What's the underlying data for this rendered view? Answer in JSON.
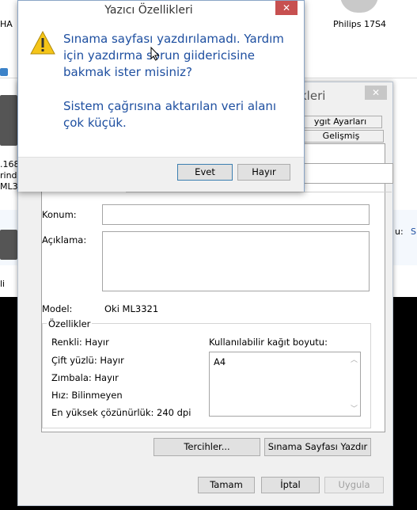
{
  "background": {
    "top_left_label": "HA",
    "monitor_label": "Philips 17S4",
    "left_printer_label_1": ".168",
    "left_printer_label_2": "rind",
    "left_printer_label_3": "ML33",
    "left_item_label": "li",
    "right_label_1": "u:",
    "right_label_2": "S"
  },
  "props_dialog": {
    "title_fragment": "kleri",
    "close_glyph": "✕",
    "tabs": [
      "ygıt Ayarları",
      "Gelişmiş"
    ],
    "location_label": "Konum:",
    "location_value": "",
    "comment_label": "Açıklama:",
    "comment_value": "",
    "model_label": "Model:",
    "model_value": "Oki ML3321",
    "features_label": "Özellikler",
    "features": {
      "color": "Renkli: Hayır",
      "duplex": "Çift yüzlü: Hayır",
      "staple": "Zımbala: Hayır",
      "speed": "Hız: Bilinmeyen",
      "resolution": "En yüksek çözünürlük: 240 dpi"
    },
    "paper_label": "Kullanılabilir kağıt boyutu:",
    "paper_sizes": [
      "A4"
    ],
    "preferences_button": "Tercihler...",
    "test_page_button": "Sınama Sayfası Yazdır",
    "ok_button": "Tamam",
    "cancel_button": "İptal",
    "apply_button": "Uygula"
  },
  "alert_dialog": {
    "title": "Yazıcı Özellikleri",
    "close_glyph": "✕",
    "message_1": "Sınama sayfası yazdırılamadı. Yardım için yazdırma sorun giidericisine bakmak ister misiniz?",
    "message_2": "Sistem çağrısına aktarılan veri alanı çok küçük.",
    "yes_button": "Evet",
    "no_button": "Hayır"
  },
  "colors": {
    "message_text": "#1e4fa0",
    "close_button": "#c75050",
    "warning_icon": "#f5c518"
  }
}
